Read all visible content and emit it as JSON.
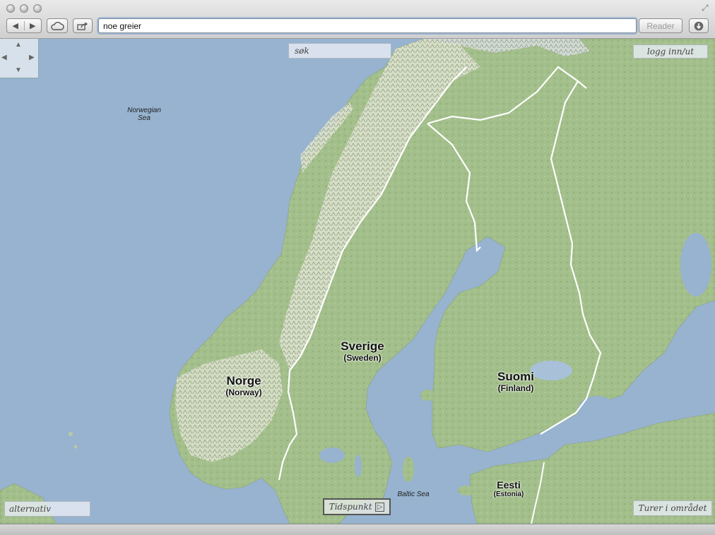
{
  "browser": {
    "address_value": "noe greier",
    "reader_label": "Reader",
    "icons": [
      "back-arrow-icon",
      "forward-arrow-icon",
      "cloud-icon",
      "share-icon",
      "download-icon",
      "fullscreen-icon"
    ]
  },
  "map": {
    "sea_labels": {
      "norwegian": [
        "Norwegian",
        "Sea"
      ],
      "baltic": "Baltic Sea"
    },
    "countries": [
      {
        "name": "Norge",
        "english": "(Norway)"
      },
      {
        "name": "Sverige",
        "english": "(Sweden)"
      },
      {
        "name": "Suomi",
        "english": "(Finland)"
      },
      {
        "name": "Eesti",
        "english": "(Estonia)"
      }
    ],
    "overlays": {
      "search": "søk",
      "login": "logg inn/ut",
      "bottom_left": "alternativ",
      "timeline": "Tidspunkt",
      "bottom_right": "Turer i området"
    },
    "colors": {
      "water": "#97b3cf",
      "land": "#a7c08e",
      "mountain": "#e6ead8",
      "border": "#ffffff"
    }
  }
}
